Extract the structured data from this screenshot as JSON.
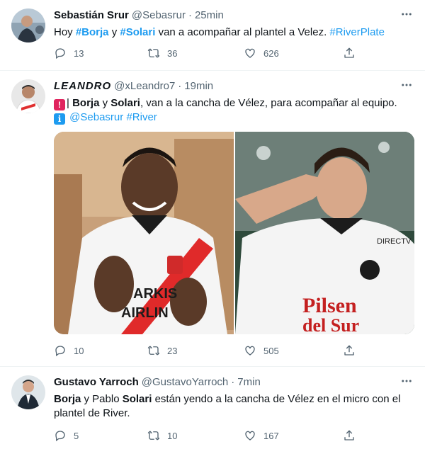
{
  "tweets": [
    {
      "name": "Sebastián Srur",
      "handle": "@Sebasrur",
      "time": "25min",
      "text": {
        "p1": "Hoy ",
        "b1": "#Borja",
        "p2": " y ",
        "b2": "#Solari",
        "p3": " van a acompañar al plantel a Velez. ",
        "l1": "#RiverPlate"
      },
      "replies": "13",
      "retweets": "36",
      "likes": "626"
    },
    {
      "name": "LEANDRO",
      "handle": "@xLeandro7",
      "time": "19min",
      "text": {
        "p1": "| ",
        "b1": "Borja",
        "p2": " y ",
        "b2": "Solari",
        "p3": ", van a la cancha de Vélez, para acompañar al equipo.",
        "l1": "@Sebasrur",
        "p4": " ",
        "l2": "#River"
      },
      "replies": "10",
      "retweets": "23",
      "likes": "505"
    },
    {
      "name": "Gustavo Yarroch",
      "handle": "@GustavoYarroch",
      "time": "7min",
      "text": {
        "b1": "Borja",
        "p1": " y Pablo ",
        "b2": "Solari",
        "p2": " están yendo a la cancha de Vélez en el micro con el plantel de River."
      },
      "replies": "5",
      "retweets": "10",
      "likes": "167"
    }
  ],
  "media": {
    "left_shirt_text": "ARKIS AIRLIN",
    "right_shirt_text": "Pilsen del Sur",
    "right_sponsor": "DIRECTV GO"
  },
  "colors": {
    "link": "#1d9bf0",
    "text": "#0f1419",
    "muted": "#536471",
    "divider": "#eff3f4"
  },
  "icons": [
    "reply-icon",
    "retweet-icon",
    "like-icon",
    "share-icon",
    "more-icon",
    "alarm-emoji",
    "info-emoji"
  ]
}
